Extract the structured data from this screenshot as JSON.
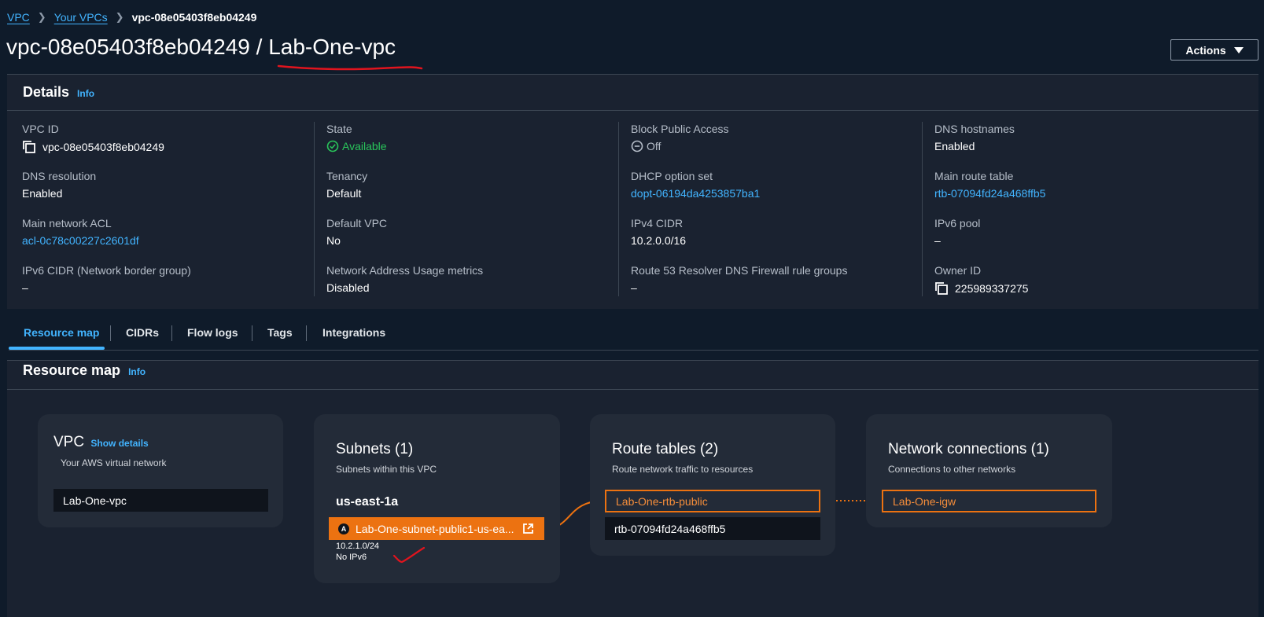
{
  "breadcrumb": {
    "root": "VPC",
    "parent": "Your VPCs",
    "current": "vpc-08e05403f8eb04249"
  },
  "title": {
    "id": "vpc-08e05403f8eb04249",
    "sep": "/",
    "name": "Lab-One-vpc"
  },
  "actions_label": "Actions",
  "details": {
    "heading": "Details",
    "info": "Info",
    "col1": [
      {
        "label": "VPC ID",
        "value": "vpc-08e05403f8eb04249"
      },
      {
        "label": "DNS resolution",
        "value": "Enabled"
      },
      {
        "label": "Main network ACL",
        "value": "acl-0c78c00227c2601df"
      },
      {
        "label": "IPv6 CIDR (Network border group)",
        "value": "–"
      }
    ],
    "col2": [
      {
        "label": "State",
        "value": "Available"
      },
      {
        "label": "Tenancy",
        "value": "Default"
      },
      {
        "label": "Default VPC",
        "value": "No"
      },
      {
        "label": "Network Address Usage metrics",
        "value": "Disabled"
      }
    ],
    "col3": [
      {
        "label": "Block Public Access",
        "value": "Off"
      },
      {
        "label": "DHCP option set",
        "value": "dopt-06194da4253857ba1"
      },
      {
        "label": "IPv4 CIDR",
        "value": "10.2.0.0/16"
      },
      {
        "label": "Route 53 Resolver DNS Firewall rule groups",
        "value": "–"
      }
    ],
    "col4": [
      {
        "label": "DNS hostnames",
        "value": "Enabled"
      },
      {
        "label": "Main route table",
        "value": "rtb-07094fd24a468ffb5"
      },
      {
        "label": "IPv6 pool",
        "value": "–"
      },
      {
        "label": "Owner ID",
        "value": "225989337275"
      }
    ]
  },
  "tabs": [
    "Resource map",
    "CIDRs",
    "Flow logs",
    "Tags",
    "Integrations"
  ],
  "resource_map": {
    "heading": "Resource map",
    "info": "Info",
    "vpc_card": {
      "title": "VPC",
      "show_details": "Show details",
      "subtitle": "Your AWS virtual network",
      "vpc_name": "Lab-One-vpc"
    },
    "subnets_card": {
      "title": "Subnets (1)",
      "subtitle": "Subnets within this VPC",
      "az": "us-east-1a",
      "az_badge": "A",
      "subnet_name": "Lab-One-subnet-public1-us-ea...",
      "cidr": "10.2.1.0/24",
      "ipv6": "No IPv6"
    },
    "route_tables_card": {
      "title": "Route tables (2)",
      "subtitle": "Route network traffic to resources",
      "items": [
        "Lab-One-rtb-public",
        "rtb-07094fd24a468ffb5"
      ]
    },
    "network_card": {
      "title": "Network connections (1)",
      "subtitle": "Connections to other networks",
      "items": [
        "Lab-One-igw"
      ]
    }
  },
  "colors": {
    "accent": "#42b4ff",
    "highlight": "#ec7211",
    "success": "#29c55a",
    "annotation": "#e0141e"
  }
}
